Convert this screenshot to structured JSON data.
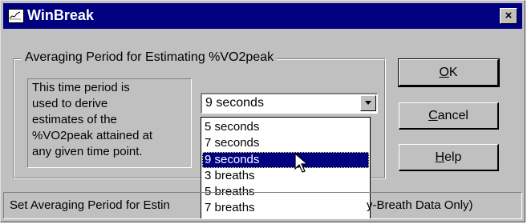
{
  "window": {
    "title": "WinBreak",
    "close_label": "×"
  },
  "group": {
    "label": "Averaging Period for Estimating %VO2peak",
    "description_lines": [
      "This time period is",
      "used to derive",
      "estimates of the",
      "%VO2peak attained at",
      "any given time point."
    ]
  },
  "combo": {
    "selected_value": "9 seconds",
    "options": [
      "5 seconds",
      "7 seconds",
      "9 seconds",
      "3 breaths",
      "5 breaths",
      "7 breaths"
    ],
    "highlighted_option": "9 seconds"
  },
  "buttons": {
    "ok": {
      "mnemonic": "O",
      "rest": "K"
    },
    "cancel": {
      "mnemonic": "C",
      "rest": "ancel"
    },
    "help": {
      "mnemonic": "H",
      "rest": "elp"
    }
  },
  "status": {
    "text_left": "Set Averaging Period for Estin",
    "text_right": "y-Breath Data Only)"
  },
  "colors": {
    "titlebar": "#000080",
    "face": "#c0c0c0",
    "selection": "#000080"
  },
  "icons": {
    "app": "chart-icon",
    "close": "close-icon",
    "dropdown": "chevron-down-icon",
    "cursor": "mouse-pointer-icon"
  }
}
